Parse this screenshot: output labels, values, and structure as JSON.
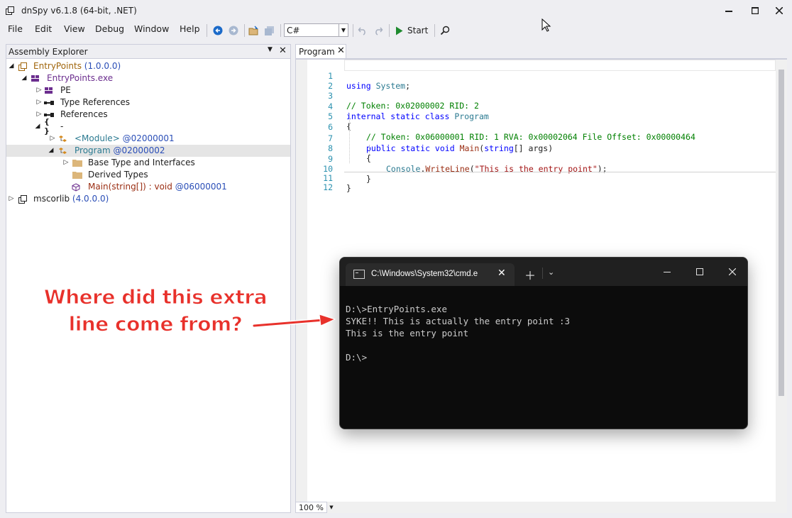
{
  "window": {
    "title": "dnSpy v6.1.8 (64-bit, .NET)"
  },
  "menu": {
    "items": [
      "File",
      "Edit",
      "View",
      "Debug",
      "Window",
      "Help"
    ]
  },
  "toolbar": {
    "language": "C#",
    "start_label": "Start"
  },
  "explorer": {
    "title": "Assembly Explorer",
    "nodes": [
      {
        "label": "EntryPoints",
        "suffix": " (1.0.0.0)"
      },
      {
        "label": "EntryPoints.exe"
      },
      {
        "label": "PE"
      },
      {
        "label": "Type References"
      },
      {
        "label": "References"
      },
      {
        "label": "-"
      },
      {
        "label": "<Module>",
        "token": " @02000001"
      },
      {
        "label": "Program",
        "token": " @02000002"
      },
      {
        "label": "Base Type and Interfaces"
      },
      {
        "label": "Derived Types"
      },
      {
        "label": "Main(string[]) : void",
        "token": " @06000001"
      },
      {
        "label": "mscorlib",
        "suffix": " (4.0.0.0)"
      }
    ]
  },
  "editor": {
    "tab_label": "Program",
    "line_numbers": [
      "1",
      "2",
      "3",
      "4",
      "5",
      "6",
      "7",
      "8",
      "9",
      "10",
      "11",
      "12"
    ],
    "code": {
      "l1_kw": "using",
      "l1_ns": "System",
      "l1_end": ";",
      "l3": "// Token: 0x02000002 RID: 2",
      "l4_kw": "internal static class",
      "l4_ty": "Program",
      "l5": "{",
      "l6": "// Token: 0x06000001 RID: 1 RVA: 0x00002064 File Offset: 0x00000464",
      "l7_kw": "public static void",
      "l7_mt": "Main",
      "l7_p1": "(",
      "l7_kw2": "string",
      "l7_p2": "[] args)",
      "l8": "{",
      "l9_ty": "Console",
      "l9_dot": ".",
      "l9_mt": "WriteLine",
      "l9_p1": "(",
      "l9_st": "\"This is the entry point\"",
      "l9_p2": ");",
      "l10": "}",
      "l11": "}"
    },
    "zoom": "100 %"
  },
  "terminal": {
    "tab_title": "C:\\Windows\\System32\\cmd.e",
    "output": "D:\\>EntryPoints.exe\nSYKE!! This is actually the entry point :3\nThis is the entry point\n\nD:\\>"
  },
  "annotation": {
    "text": "Where did this extra line come from?",
    "color": "#E8312B"
  },
  "colors": {
    "keyword": "#0000FF",
    "type": "#2B7A91",
    "comment": "#008000",
    "string": "#A31515"
  }
}
